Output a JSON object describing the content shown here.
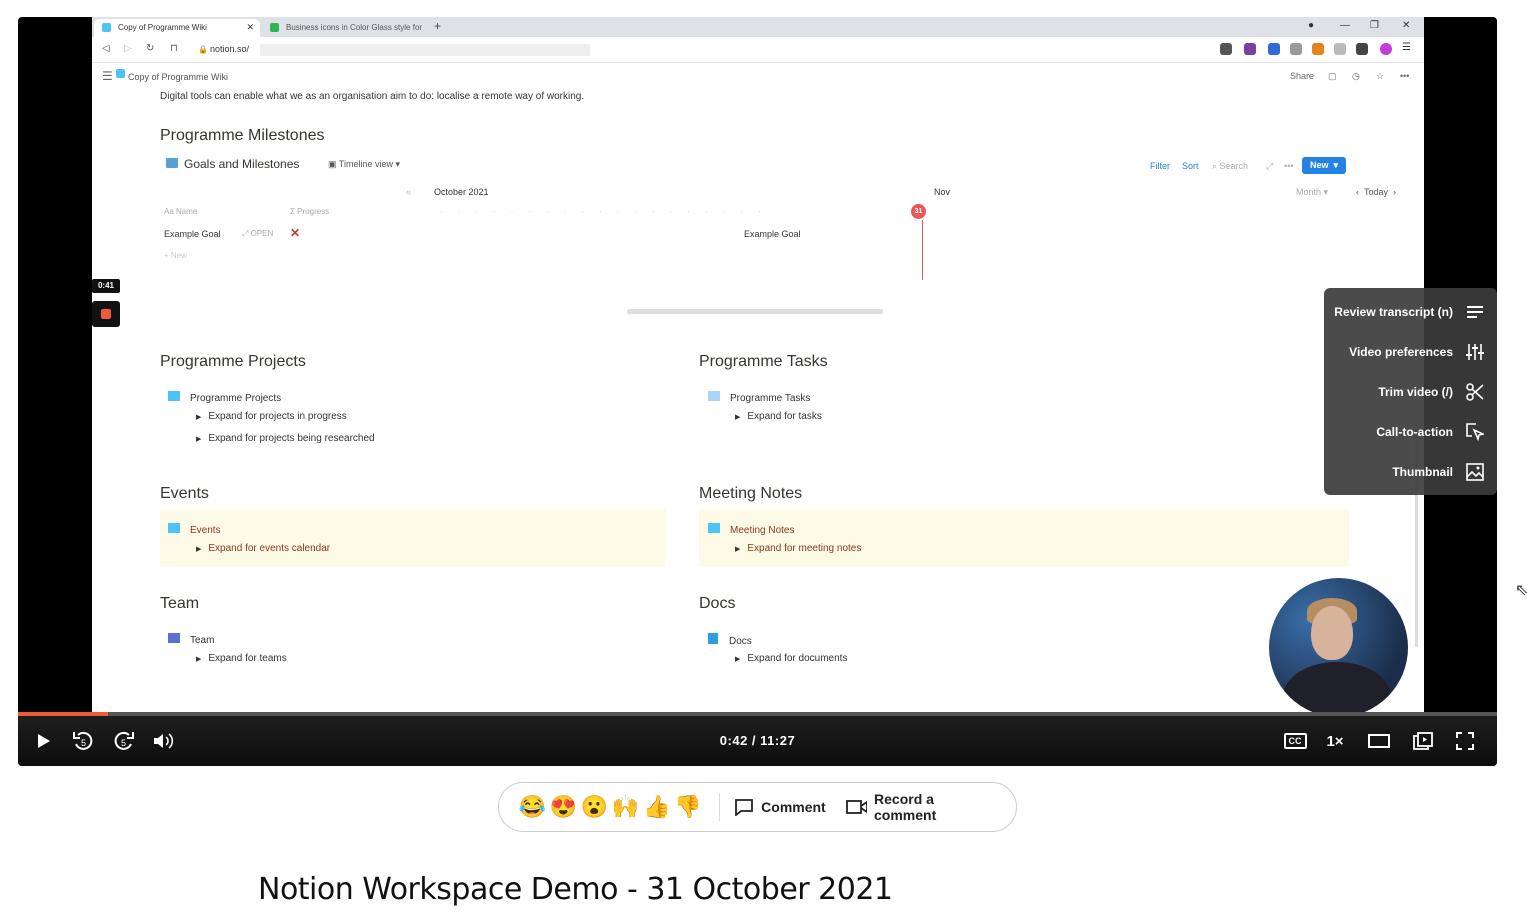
{
  "browser": {
    "tabs": [
      {
        "label": "Copy of Programme Wiki",
        "active": true
      },
      {
        "label": "Business icons in Color Glass style for",
        "active": false
      }
    ],
    "url": "notion.so/",
    "new_tab": "+"
  },
  "notion": {
    "page_title": "Copy of Programme Wiki",
    "share_label": "Share",
    "intro_text": "Digital tools can enable what we as an organisation aim to do: localise a remote way of working.",
    "milestones": {
      "heading": "Programme Milestones",
      "db_title": "Goals and Milestones",
      "view": "Timeline view",
      "filter": "Filter",
      "sort": "Sort",
      "search": "Search",
      "new_btn": "New",
      "month_label": "October 2021",
      "next_month": "Nov",
      "today_day": "31",
      "month_select": "Month",
      "today_label": "Today",
      "col_name": "Aa Name",
      "col_progress": "Σ Progress",
      "row_name": "Example Goal",
      "row_open": "OPEN",
      "bar_label": "Example Goal",
      "new_row": "+ New"
    },
    "projects": {
      "heading": "Programme Projects",
      "db": "Programme Projects",
      "items": [
        "Expand for projects in progress",
        "Expand for projects being researched"
      ]
    },
    "tasks": {
      "heading": "Programme Tasks",
      "db": "Programme Tasks",
      "items": [
        "Expand for tasks"
      ]
    },
    "events": {
      "heading": "Events",
      "db": "Events",
      "items": [
        "Expand for events calendar"
      ]
    },
    "meetings": {
      "heading": "Meeting Notes",
      "db": "Meeting Notes",
      "items": [
        "Expand for meeting notes"
      ]
    },
    "team": {
      "heading": "Team",
      "db": "Team",
      "items": [
        "Expand for teams"
      ]
    },
    "docs": {
      "heading": "Docs",
      "db": "Docs",
      "items": [
        "Expand for documents"
      ]
    }
  },
  "recording": {
    "time": "0:41"
  },
  "menu": {
    "items": [
      {
        "label": "Review transcript (n)",
        "icon": "lines-icon"
      },
      {
        "label": "Video preferences",
        "icon": "sliders-icon"
      },
      {
        "label": "Trim video (/)",
        "icon": "scissors-icon"
      },
      {
        "label": "Call-to-action",
        "icon": "cursor-click-icon"
      },
      {
        "label": "Thumbnail",
        "icon": "image-icon"
      }
    ]
  },
  "player": {
    "time": "0:42 / 11:27",
    "progress": 0.061,
    "rewind_label": "5",
    "forward_label": "5",
    "cc_label": "CC",
    "speed": "1×",
    "accent": "#f05a3a"
  },
  "reactions": {
    "emojis": [
      "😂",
      "😍",
      "😮",
      "🙌",
      "👍",
      "👎"
    ],
    "comment": "Comment",
    "record_comment": "Record a comment"
  },
  "video_title": "Notion Workspace Demo - 31 October 2021"
}
